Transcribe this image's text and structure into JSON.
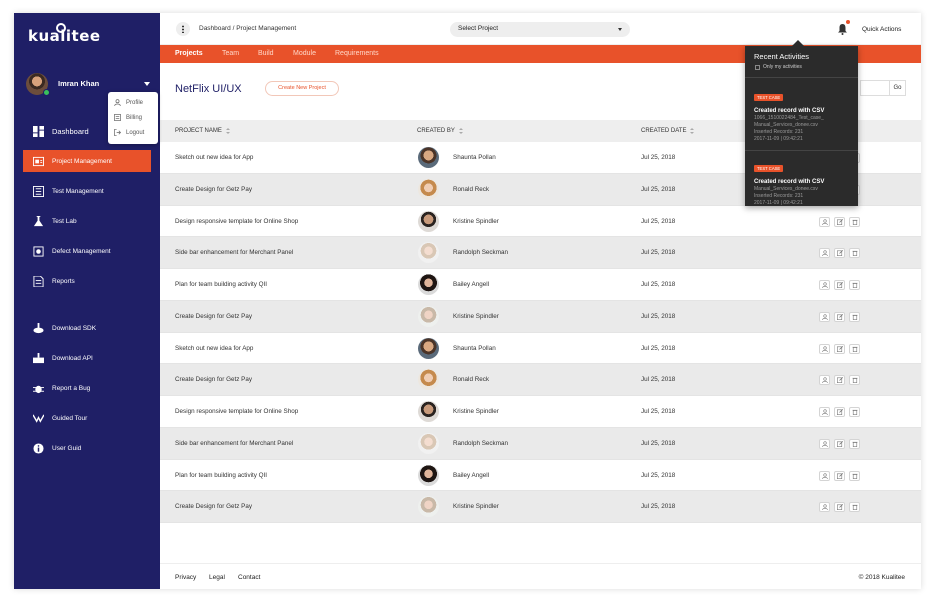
{
  "brand": {
    "logo_text": "kualitee"
  },
  "user": {
    "name": "Imran Khan"
  },
  "user_menu": [
    {
      "label": "Profile",
      "icon": "user-icon"
    },
    {
      "label": "Billing",
      "icon": "billing-icon"
    },
    {
      "label": "Logout",
      "icon": "logout-icon"
    }
  ],
  "sidebar": {
    "items": [
      {
        "label": "Dashboard",
        "icon": "dashboard-icon",
        "active": false
      },
      {
        "label": "Project Management",
        "icon": "project-icon",
        "active": true
      },
      {
        "label": "Test Management",
        "icon": "test-management-icon",
        "active": false
      },
      {
        "label": "Test Lab",
        "icon": "flask-icon",
        "active": false
      },
      {
        "label": "Defect Management",
        "icon": "bug-icon",
        "active": false
      },
      {
        "label": "Reports",
        "icon": "reports-icon",
        "active": false
      }
    ],
    "secondary": [
      {
        "label": "Download SDK",
        "icon": "download-sdk-icon"
      },
      {
        "label": "Download API",
        "icon": "download-api-icon"
      },
      {
        "label": "Report a Bug",
        "icon": "report-bug-icon"
      },
      {
        "label": "Guided Tour",
        "icon": "tour-icon"
      },
      {
        "label": "User Guid",
        "icon": "info-icon"
      }
    ]
  },
  "topbar": {
    "breadcrumb": "Dashboard / Project Management",
    "select_project": "Select Project",
    "quick_actions": "Quick Actions"
  },
  "tabs": [
    "Projects",
    "Team",
    "Build",
    "Module",
    "Requirements"
  ],
  "page": {
    "title": "NetFlix UI/UX",
    "create_button": "Create New Project",
    "go_button": "Go"
  },
  "table": {
    "headers": [
      "PROJECT NAME",
      "CREATED BY",
      "CREATED DATE"
    ],
    "rows": [
      {
        "name": "Sketch out new idea for App",
        "by": "Shaunta Pollan",
        "date": "Jul 25, 2018",
        "avatar": "m1"
      },
      {
        "name": "Create Design for Getz Pay",
        "by": "Ronald Reck",
        "date": "Jul 25, 2018",
        "avatar": "f1"
      },
      {
        "name": "Design responsive template for Online Shop",
        "by": "Kristine Spindler",
        "date": "Jul 25, 2018",
        "avatar": "m2"
      },
      {
        "name": "Side bar enhancement for Merchant Panel",
        "by": "Randolph Seckman",
        "date": "Jul 25, 2018",
        "avatar": "f2"
      },
      {
        "name": "Plan for team building activity QII",
        "by": "Bailey Angell",
        "date": "Jul 25, 2018",
        "avatar": "f3"
      },
      {
        "name": "Create Design for Getz Pay",
        "by": "Kristine Spindler",
        "date": "Jul 25, 2018",
        "avatar": "f4"
      },
      {
        "name": "Sketch out new idea for App",
        "by": "Shaunta Pollan",
        "date": "Jul 25, 2018",
        "avatar": "m1"
      },
      {
        "name": "Create Design for Getz Pay",
        "by": "Ronald Reck",
        "date": "Jul 25, 2018",
        "avatar": "f1"
      },
      {
        "name": "Design responsive template for Online Shop",
        "by": "Kristine Spindler",
        "date": "Jul 25, 2018",
        "avatar": "m2"
      },
      {
        "name": "Side bar enhancement for Merchant Panel",
        "by": "Randolph Seckman",
        "date": "Jul 25, 2018",
        "avatar": "f2"
      },
      {
        "name": "Plan for team building activity QII",
        "by": "Bailey Angell",
        "date": "Jul 25, 2018",
        "avatar": "f3"
      },
      {
        "name": "Create Design for Getz Pay",
        "by": "Kristine Spindler",
        "date": "Jul 25, 2018",
        "avatar": "f4"
      }
    ]
  },
  "footer": {
    "links": [
      "Privacy",
      "Legal",
      "Contact"
    ],
    "copyright": "© 2018 Kualitee"
  },
  "recent_activities": {
    "title": "Recent Activities",
    "filter_label": "Only my activities",
    "items": [
      {
        "tag": "TEST CASE",
        "title": "Created record with CSV",
        "lines": [
          "1066_1510022484_Test_case_",
          "Manual_Services_donee.csv",
          "Inserted Records: 231",
          "2017-11-09 | 09:42:21"
        ]
      },
      {
        "tag": "TEST CASE",
        "title": "Created record with CSV",
        "lines": [
          "Manual_Services_donee.csv",
          "Inserted Records: 231",
          "2017-11-09 | 09:42:21"
        ]
      }
    ]
  },
  "colors": {
    "sidebar": "#1f1f66",
    "accent": "#e8522a",
    "popover": "#2b2b2b"
  }
}
